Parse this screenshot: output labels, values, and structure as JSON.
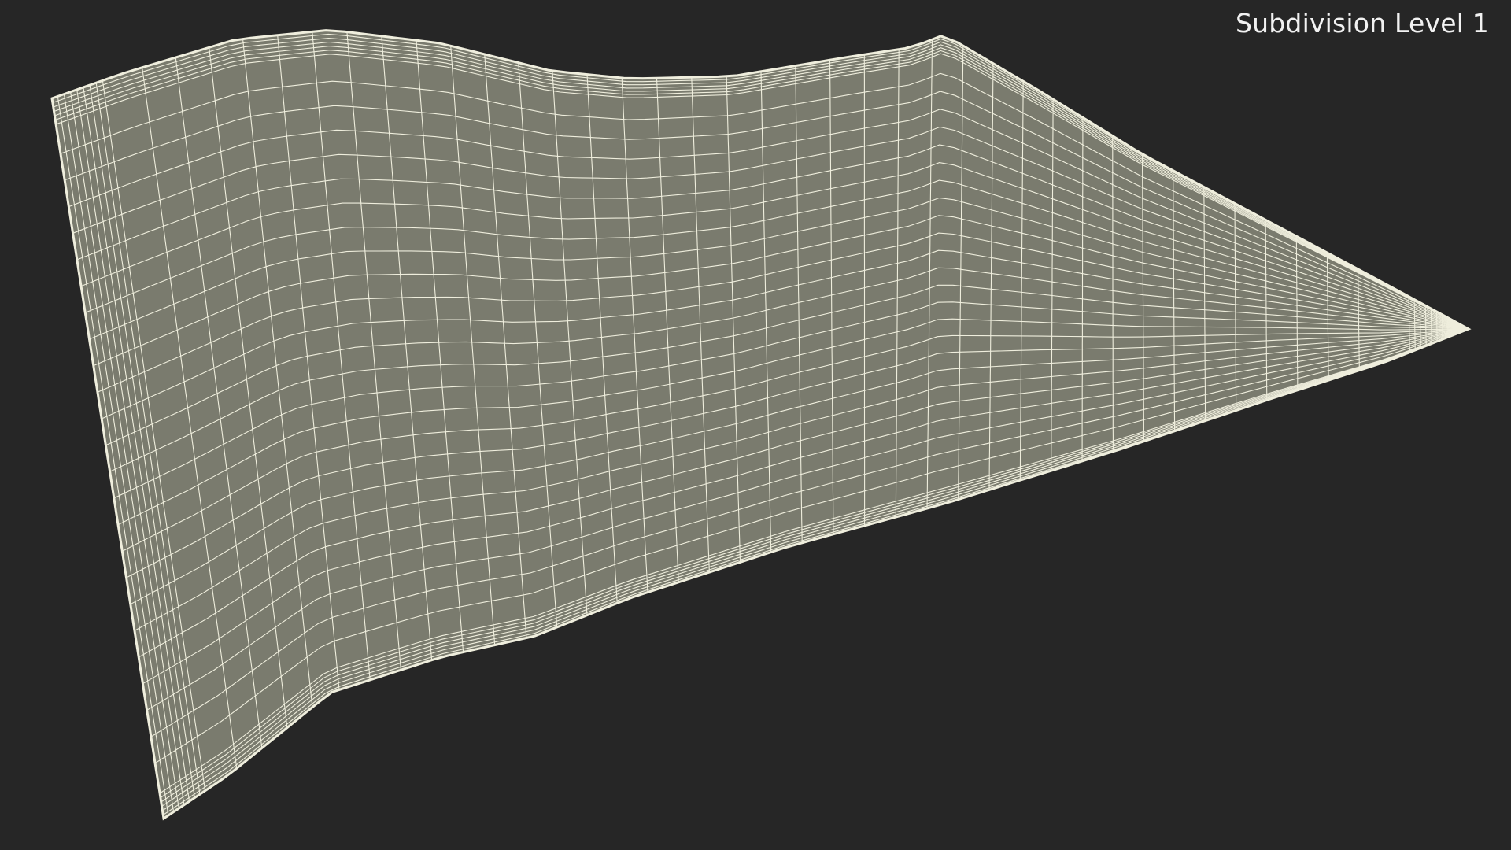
{
  "viewport": {
    "overlay_label": "Subdivision Level 1",
    "colors": {
      "background": "#262626",
      "surface": "#7a7b6e",
      "wire": "#efeedd",
      "overlay_text": "#f2f2f2"
    },
    "render_mode": "wireframe-on-shaded",
    "object": "curved cloth panel mesh"
  }
}
